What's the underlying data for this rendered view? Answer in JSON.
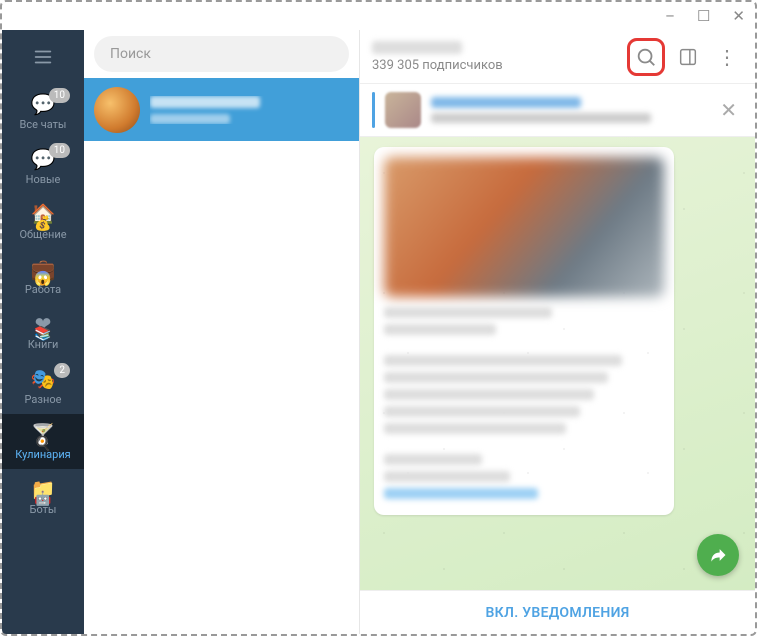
{
  "window": {
    "minimize": "–",
    "maximize": "☐",
    "close": "✕"
  },
  "rail": {
    "items": [
      {
        "icon": "💬",
        "label": "Все чаты",
        "badge": "10"
      },
      {
        "icon": "💬",
        "label": "Новые",
        "badge": "10"
      },
      {
        "icon": "🏠",
        "label": "Общение",
        "sub": "💰"
      },
      {
        "icon": "💼",
        "label": "Работа",
        "sub": "😱"
      },
      {
        "icon": "❤",
        "label": "Книги",
        "sub": "📚"
      },
      {
        "icon": "🎭",
        "label": "Разное",
        "badge": "2"
      },
      {
        "icon": "🍸",
        "label": "Кулинария",
        "sub": "🍳",
        "active": true
      },
      {
        "icon": "📁",
        "label": "Боты",
        "sub": "🤖"
      }
    ]
  },
  "search": {
    "placeholder": "Поиск"
  },
  "header": {
    "subscribers": "339 305 подписчиков"
  },
  "mute": {
    "label": "ВКЛ. УВЕДОМЛЕНИЯ"
  }
}
